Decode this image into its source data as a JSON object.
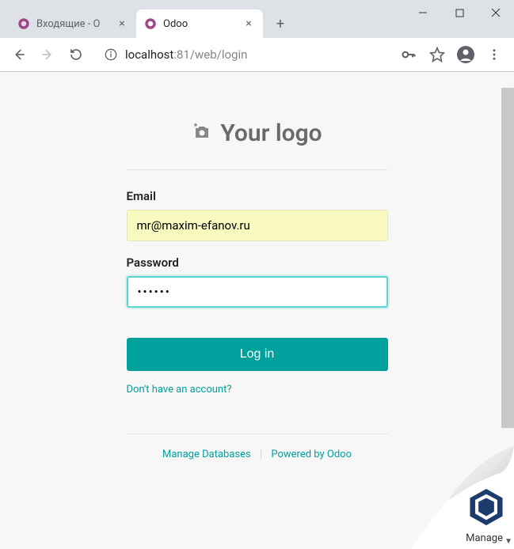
{
  "browser": {
    "tabs": [
      {
        "title": "Входящие - О",
        "active": false
      },
      {
        "title": "Odoo",
        "active": true
      }
    ],
    "url_host": "localhost",
    "url_port": ":81",
    "url_path": "/web/login"
  },
  "page": {
    "logo_text": "Your logo",
    "email_label": "Email",
    "email_value": "mr@maxim-efanov.ru",
    "password_label": "Password",
    "password_value": "••••••",
    "login_button": "Log in",
    "signup_link": "Don't have an account?",
    "footer_manage": "Manage Databases",
    "footer_powered": "Powered by Odoo"
  },
  "badge": {
    "label": "Manage"
  }
}
